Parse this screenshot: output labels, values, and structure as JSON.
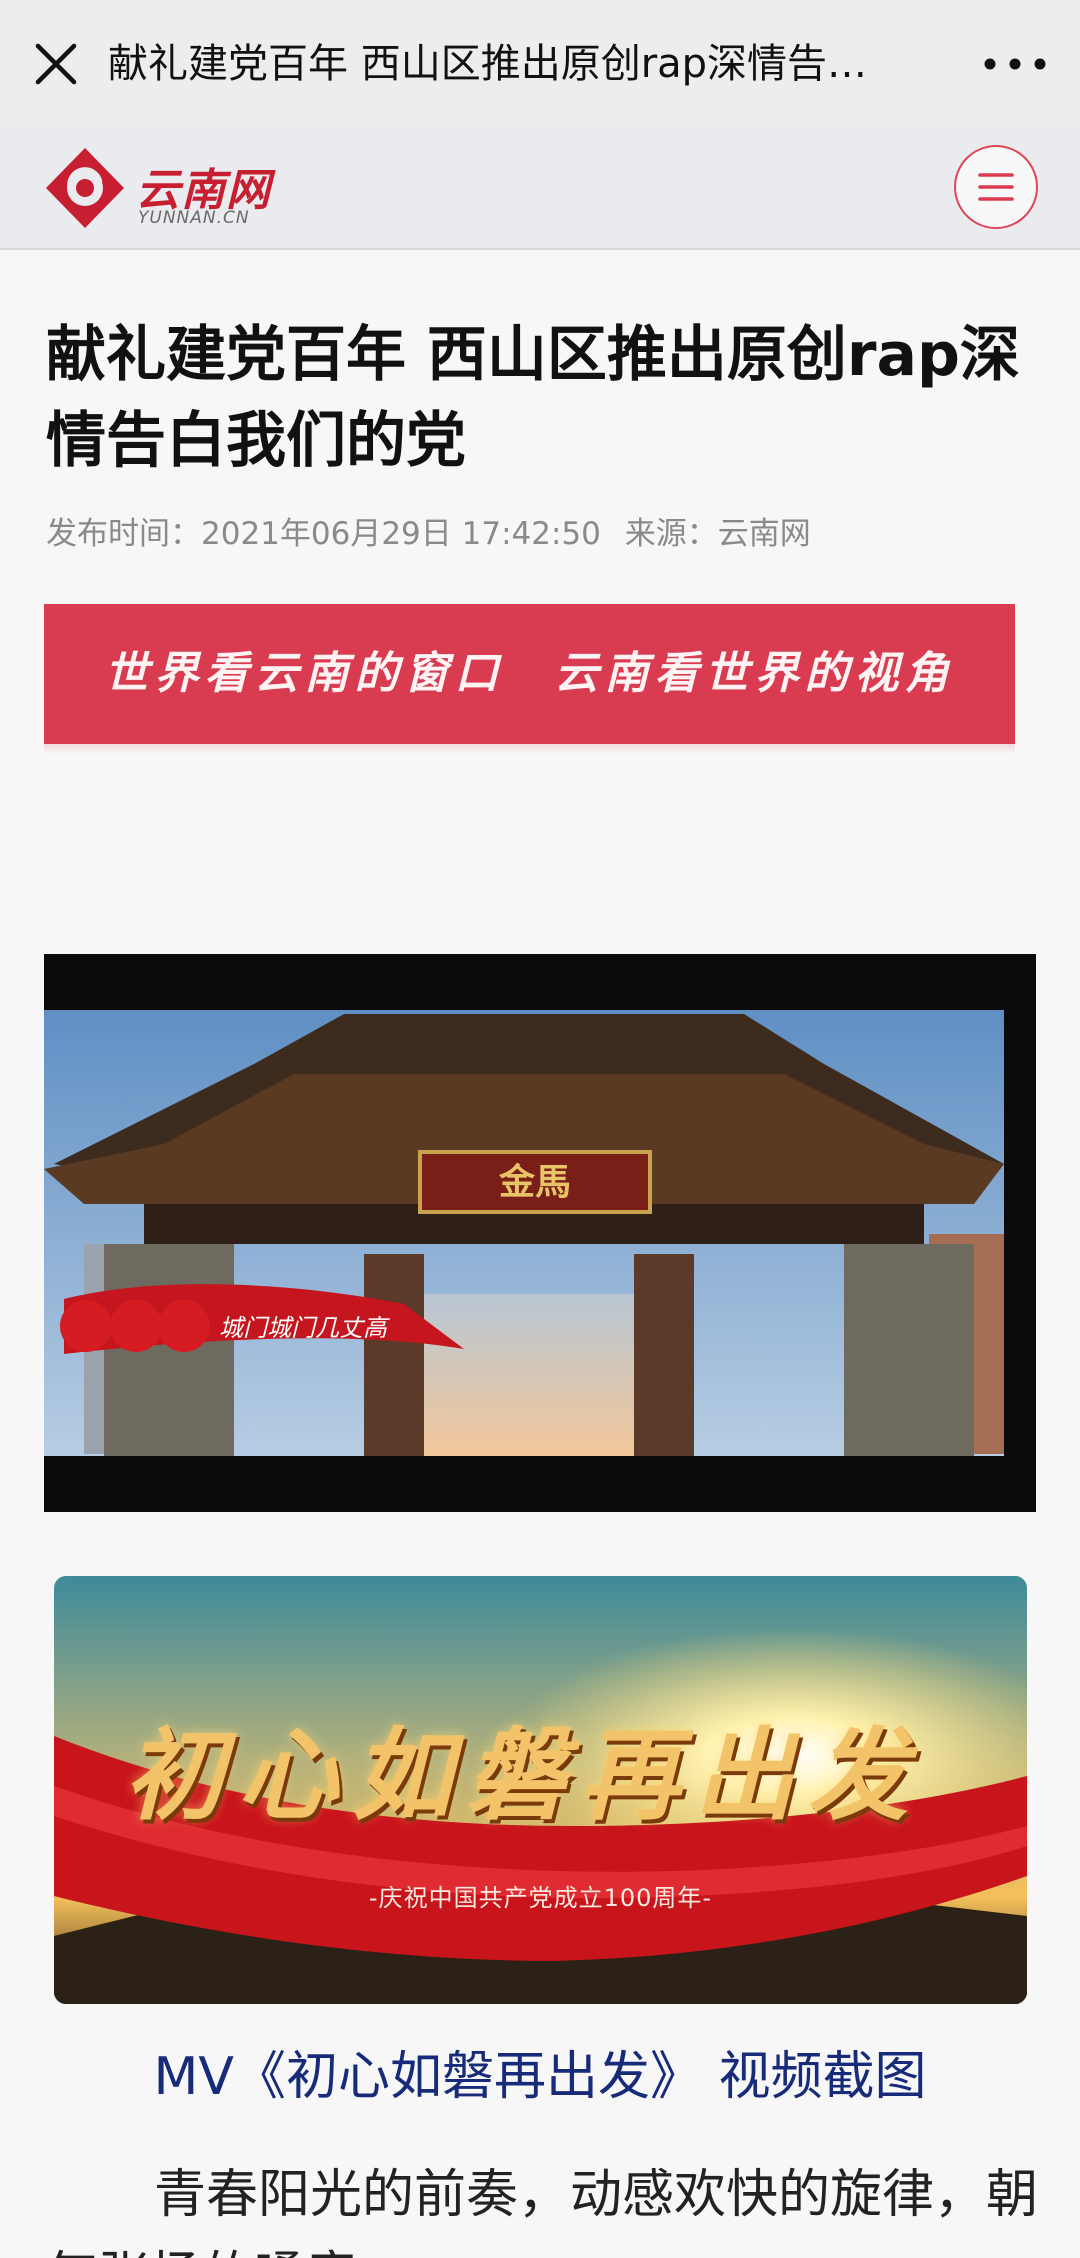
{
  "topbar": {
    "title": "献礼建党百年 西山区推出原创rap深情告…",
    "close_icon": "close-icon",
    "more_icon": "more-dots-icon"
  },
  "site": {
    "logo_name": "云南网",
    "logo_sub": "YUNNAN.CN",
    "menu_icon": "hamburger-menu-icon",
    "brand_color": "#c71e32"
  },
  "article": {
    "title": "献礼建党百年 西山区推出原创rap深情告白我们的党",
    "publish_label": "发布时间：",
    "publish_time": "2021年06月29日 17:42:50",
    "source_label": "来源：",
    "source": "云南网"
  },
  "slogan": {
    "text": "世界看云南的窗口　云南看世界的视角",
    "color": "#d93c50"
  },
  "video": {
    "gate_plaque": "金馬",
    "ribbon_text": "城门城门几丈高"
  },
  "banner": {
    "title": "初心如磐再出发",
    "subtitle": "-庆祝中国共产党成立100周年-"
  },
  "caption": "MV《初心如磐再出发》 视频截图",
  "paragraph": "青春阳光的前奏，动感欢快的旋律，朝气张扬的嗓音"
}
